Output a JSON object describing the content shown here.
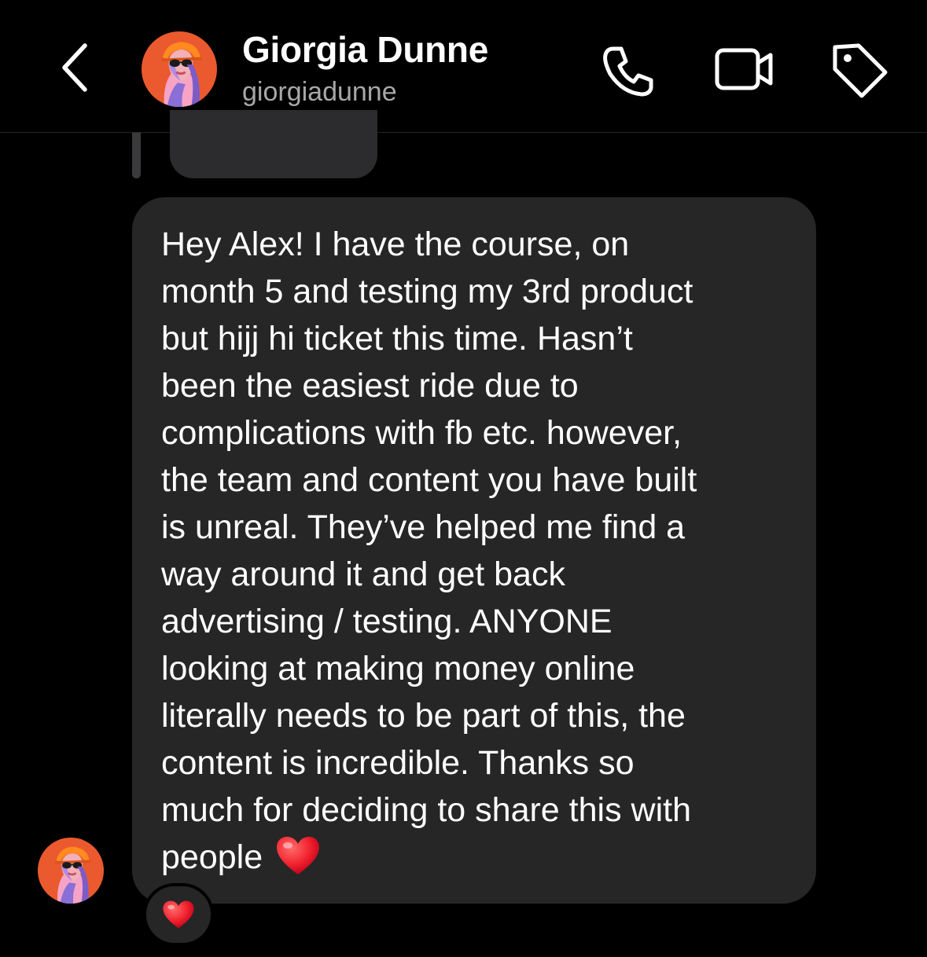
{
  "header": {
    "contact_name": "Giorgia Dunne",
    "contact_handle": "giorgiadunne",
    "icons": [
      "chevron-left-icon",
      "phone-icon",
      "video-camera-icon",
      "tag-icon"
    ]
  },
  "message": {
    "text": "Hey Alex! I have the course, on\nmonth 5 and testing my 3rd product\nbut hijj hi ticket this time. Hasn’t\nbeen the easiest ride due to\ncomplications with fb etc. however,\nthe team and content you have built\nis unreal. They’ve helped me find a\nway around it and get back\nadvertising / testing. ANYONE\nlooking at making money online\nliterally needs to be part of this, the\ncontent is incredible. Thanks so\nmuch for deciding to share this with\npeople",
    "emoji": "red-heart"
  },
  "reaction": {
    "emoji": "red-heart"
  },
  "colors": {
    "background": "#000000",
    "bubble": "#262626",
    "secondary_text": "#a8a8a8",
    "heart": "#ff2d3f",
    "avatar_bg": "#ea5a2e"
  }
}
